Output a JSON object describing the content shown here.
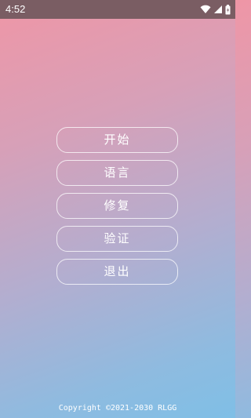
{
  "status_bar": {
    "time": "4:52",
    "icons": [
      "wifi-icon",
      "signal-icon",
      "battery-icon"
    ],
    "background": "#7a5d63"
  },
  "menu": {
    "items": [
      {
        "label": "开始"
      },
      {
        "label": "语言"
      },
      {
        "label": "修复"
      },
      {
        "label": "验证"
      },
      {
        "label": "退出"
      }
    ]
  },
  "footer": {
    "copyright": "Copyright ©2021-2030 RLGG"
  },
  "colors": {
    "gradient_top": "#ef96a6",
    "gradient_bottom": "#7fbfe6",
    "button_border": "#ffffff",
    "text": "#ffffff"
  }
}
